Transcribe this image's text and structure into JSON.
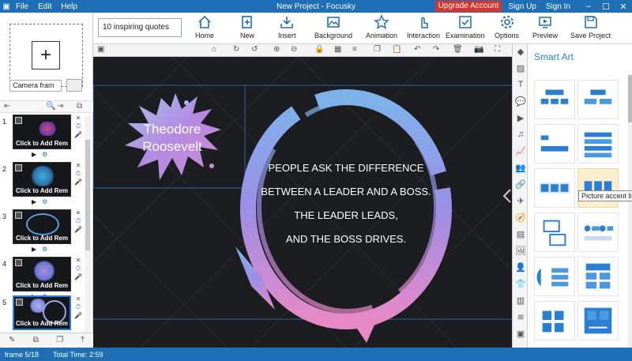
{
  "app": {
    "title": "New Project - Focusky",
    "menu": [
      "File",
      "Edit",
      "Help"
    ],
    "upgrade": "Upgrade Account",
    "signup": "Sign Up",
    "signin": "Sign In"
  },
  "toolbar": {
    "search_value": "10 inspiring quotes",
    "buttons": [
      "Home",
      "New",
      "Insert",
      "Background",
      "Animation",
      "Interaction",
      "Examination",
      "Options",
      "Preview",
      "Save Project"
    ]
  },
  "left": {
    "camera_select": "Camera fram",
    "frames": [
      {
        "num": "1",
        "label": "Click to Add Rem"
      },
      {
        "num": "2",
        "label": "Click to Add Rem"
      },
      {
        "num": "3",
        "label": "Click to Add Rem"
      },
      {
        "num": "4",
        "label": "Click to Add Rem"
      },
      {
        "num": "5",
        "label": "Click to Add Rem"
      }
    ]
  },
  "canvas": {
    "name_line1": "Theodore",
    "name_line2": "Roosevelt",
    "quote": [
      "PEOPLE ASK THE DIFFERENCE",
      "BETWEEN A LEADER AND A BOSS.",
      "THE LEADER LEADS,",
      "AND THE BOSS DRIVES."
    ]
  },
  "right": {
    "title": "Smart Art",
    "tooltip": "Picture accent list"
  },
  "status": {
    "frame": "frame 5/18",
    "total": "Total Time: 2:59"
  }
}
